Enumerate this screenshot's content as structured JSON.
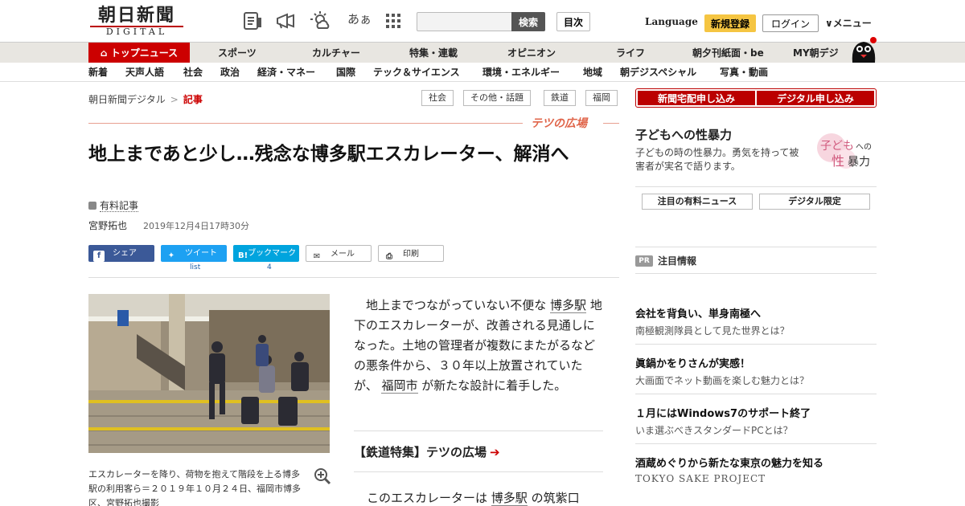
{
  "header": {
    "logo_main": "朝日新聞",
    "logo_sub": "DIGITAL",
    "font_toggle": "あぁ",
    "search_label": "検索",
    "index_label": "目次",
    "language_label": "Language",
    "register_label": "新規登録",
    "login_label": "ログイン",
    "menu_label": "メニュー"
  },
  "nav_main": [
    "トップニュース",
    "スポーツ",
    "カルチャー",
    "特集・連載",
    "オピニオン",
    "ライフ",
    "朝夕刊紙面・be",
    "MY朝デジ"
  ],
  "nav_sub": [
    "新着",
    "天声人語",
    "社会",
    "政治",
    "経済・マネー",
    "国際",
    "テック＆サイエンス",
    "環境・エネルギー",
    "地域",
    "朝デジスペシャル",
    "写真・動画"
  ],
  "breadcrumb": {
    "home": "朝日新聞デジタル",
    "sep": ">",
    "current": "記事"
  },
  "tags": [
    "社会",
    "その他・話題",
    "鉄道",
    "福岡"
  ],
  "section_title": "テツの広場",
  "article": {
    "headline": "地上まであと少し…残念な博多駅エスカレーター、解消へ",
    "paid_label": "有料記事",
    "author": "宮野拓也",
    "date": "2019年12月4日17時30分",
    "share": {
      "facebook": "シェア",
      "twitter": "ツイート",
      "hatena": "ブックマーク",
      "mail": "メール",
      "print": "印刷",
      "twitter_count": "list",
      "hatena_count": "4"
    },
    "caption": "エスカレーターを降り、荷物を抱えて階段を上る博多駅の利用客ら＝２０１９年１０月２４日、福岡市博多区、宮野拓也撮影",
    "body_1a": "地上までつながっていない不便な",
    "body_link1": "博多駅",
    "body_1b": "地下のエスカレーターが、改善される見通しになった。土地の管理者が複数にまたがるなどの悪条件から、３０年以上放置されていたが、",
    "body_link2": "福岡市",
    "body_1c": "が新たな設計に着手した。",
    "feature_link": "【鉄道特集】テツの広場",
    "feature_arrow": "➔",
    "body_2a": "このエスカレーターは",
    "body_link3": "博多駅",
    "body_2b": "の筑紫口"
  },
  "sidebar": {
    "apply_home": "新聞宅配申し込み",
    "apply_digital": "デジタル申し込み",
    "promo_title": "子どもへの性暴力",
    "promo_text": "子どもの時の性暴力。勇気を持って被害者が実名で語ります。",
    "promo_logo_a": "子ども",
    "promo_logo_b": "への",
    "promo_logo_c": "性",
    "promo_logo_d": "暴力",
    "pill_paid": "注目の有料ニュース",
    "pill_digital": "デジタル限定",
    "pr_badge": "PR",
    "pr_title": "注目情報",
    "ads": [
      {
        "title": "会社を背負い、単身南極へ",
        "sub": "南極観測隊員として見た世界とは？"
      },
      {
        "title": "眞鍋かをりさんが実感！",
        "sub": "大画面でネット動画を楽しむ魅力とは？"
      },
      {
        "title": "１月にはWindows7のサポート終了",
        "sub": "いま選ぶべきスタンダードPCとは？"
      },
      {
        "title": "酒蔵めぐりから新たな東京の魅力を知る",
        "sub": "TOKYO SAKE PROJECT"
      }
    ]
  },
  "colors": {
    "brand_red": "#c00000",
    "accent_orange": "#e0654a",
    "register_yellow": "#f5c542"
  }
}
